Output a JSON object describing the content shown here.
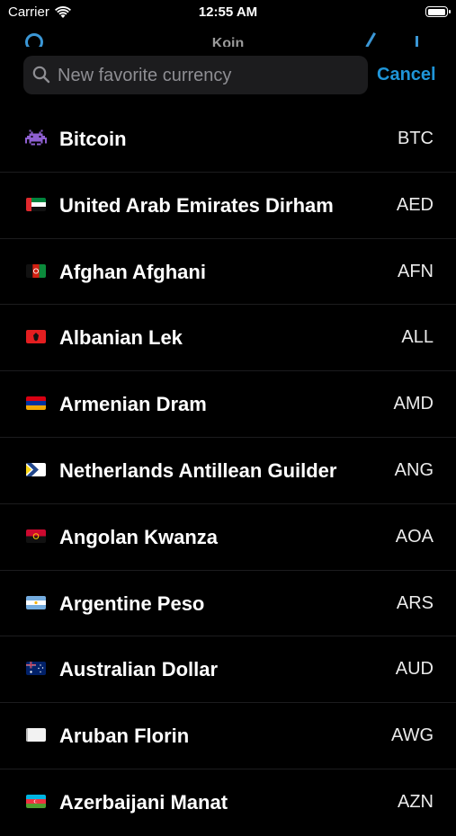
{
  "status_bar": {
    "carrier": "Carrier",
    "time": "12:55 AM",
    "battery_level": 0.95
  },
  "nav_peek": {
    "title": "Koin"
  },
  "search": {
    "placeholder": "New favorite currency",
    "value": "",
    "cancel_label": "Cancel"
  },
  "colors": {
    "background": "#000000",
    "accent": "#1f95d8",
    "search_field": "#1c1c1e",
    "separator": "#1c1c1e"
  },
  "currencies": [
    {
      "name": "Bitcoin",
      "code": "BTC",
      "icon": "space-invader-icon"
    },
    {
      "name": "United Arab Emirates Dirham",
      "code": "AED",
      "icon": "flag-uae-icon"
    },
    {
      "name": "Afghan Afghani",
      "code": "AFN",
      "icon": "flag-afghanistan-icon"
    },
    {
      "name": "Albanian Lek",
      "code": "ALL",
      "icon": "flag-albania-icon"
    },
    {
      "name": "Armenian Dram",
      "code": "AMD",
      "icon": "flag-armenia-icon"
    },
    {
      "name": "Netherlands Antillean Guilder",
      "code": "ANG",
      "icon": "flag-netherlands-antilles-icon"
    },
    {
      "name": "Angolan Kwanza",
      "code": "AOA",
      "icon": "flag-angola-icon"
    },
    {
      "name": "Argentine Peso",
      "code": "ARS",
      "icon": "flag-argentina-icon"
    },
    {
      "name": "Australian Dollar",
      "code": "AUD",
      "icon": "flag-australia-icon"
    },
    {
      "name": "Aruban Florin",
      "code": "AWG",
      "icon": "white-flag-icon"
    },
    {
      "name": "Azerbaijani Manat",
      "code": "AZN",
      "icon": "flag-azerbaijan-icon"
    }
  ]
}
